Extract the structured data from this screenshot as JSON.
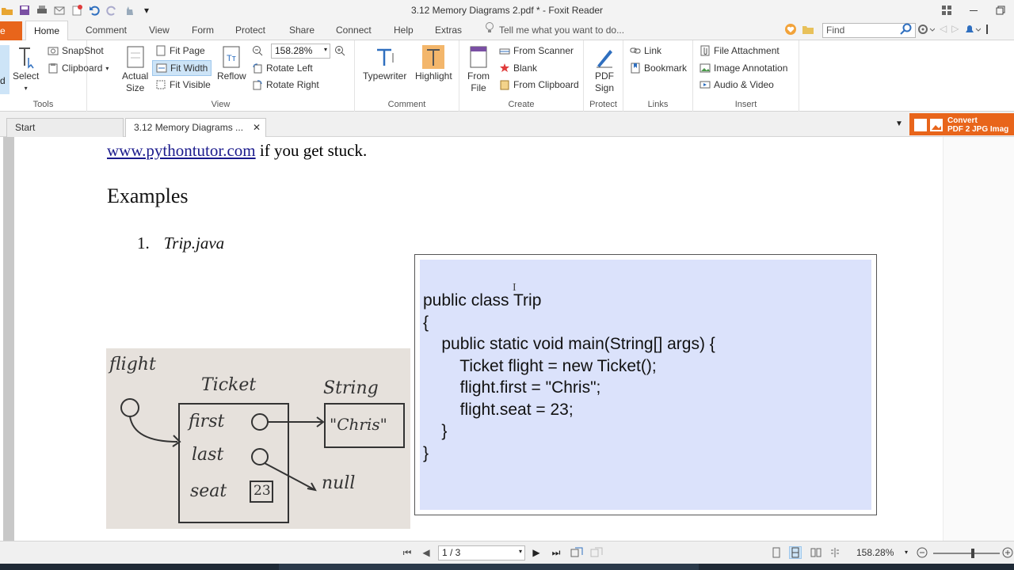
{
  "window": {
    "title": "3.12 Memory Diagrams 2.pdf * - Foxit Reader"
  },
  "ribbon_tabs": {
    "file": "e",
    "home": "Home",
    "comment": "Comment",
    "view": "View",
    "form": "Form",
    "protect": "Protect",
    "share": "Share",
    "connect": "Connect",
    "help": "Help",
    "extras": "Extras",
    "tell_me": "Tell me what you want to do..."
  },
  "find": {
    "placeholder": "Find"
  },
  "ribbon": {
    "tools": {
      "label": "Tools",
      "select": "Select",
      "hand_fragment": "d",
      "snapshot": "SnapShot",
      "clipboard": "Clipboard"
    },
    "view": {
      "label": "View",
      "actual_size_1": "Actual",
      "actual_size_2": "Size",
      "fit_page": "Fit Page",
      "fit_width": "Fit Width",
      "fit_visible": "Fit Visible",
      "reflow": "Reflow",
      "zoom": "158.28%",
      "rotate_left": "Rotate Left",
      "rotate_right": "Rotate Right"
    },
    "comment": {
      "label": "Comment",
      "typewriter": "Typewriter",
      "highlight": "Highlight"
    },
    "create": {
      "label": "Create",
      "from_file_1": "From",
      "from_file_2": "File",
      "from_scanner": "From Scanner",
      "blank": "Blank",
      "from_clipboard": "From Clipboard"
    },
    "protect": {
      "label": "Protect",
      "pdf_sign_1": "PDF",
      "pdf_sign_2": "Sign"
    },
    "links": {
      "label": "Links",
      "link": "Link",
      "bookmark": "Bookmark"
    },
    "insert": {
      "label": "Insert",
      "file_attachment": "File Attachment",
      "image_annotation": "Image Annotation",
      "audio_video": "Audio & Video"
    }
  },
  "doc_tabs": {
    "start": "Start",
    "current": "3.12 Memory Diagrams ..."
  },
  "promo": {
    "line1": "Convert",
    "line2": "PDF 2 JPG Imag"
  },
  "document": {
    "link_text": "www.pythontutor.com",
    "link_suffix": " if you get stuck.",
    "heading": "Examples",
    "list_number": "1.",
    "list_title": "Trip.java",
    "code": [
      "public class Trip",
      "{",
      "    public static void main(String[] args) {",
      "        Ticket flight = new Ticket();",
      "        flight.first = \"Chris\";",
      "        flight.seat = 23;",
      "    }",
      "}"
    ],
    "diagram": {
      "var_name": "flight",
      "class_name": "Ticket",
      "string_label": "String",
      "field_first": "first",
      "field_last": "last",
      "field_seat": "seat",
      "seat_value": "23",
      "string_value": "\"Chris\"",
      "null_value": "null"
    }
  },
  "status": {
    "page": "1 / 3",
    "zoom": "158.28%"
  },
  "colors": {
    "accent_orange": "#e8651b",
    "code_bg": "#dbe2fb"
  }
}
